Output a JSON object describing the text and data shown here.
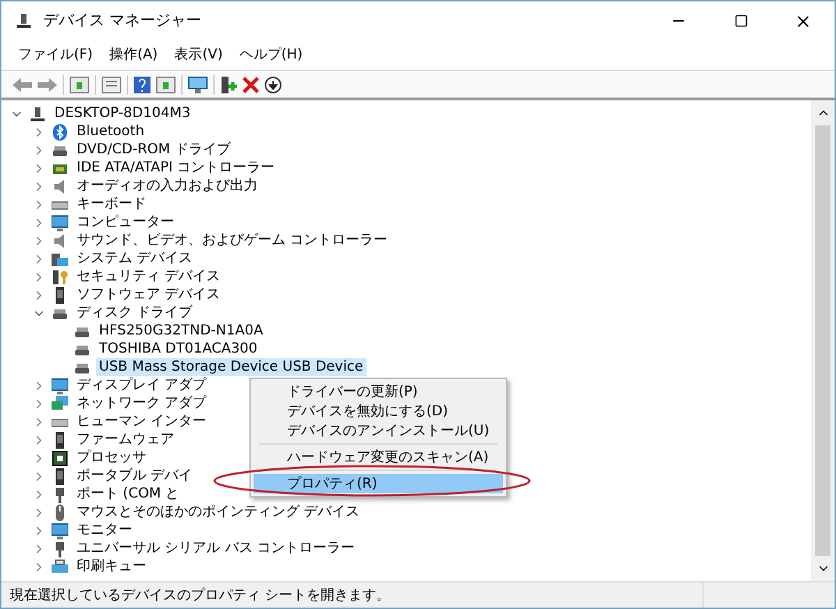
{
  "window": {
    "title": "デバイス マネージャー"
  },
  "menu_bar": [
    "ファイル(F)",
    "操作(A)",
    "表示(V)",
    "ヘルプ(H)"
  ],
  "tree": {
    "label": "DESKTOP-8D104M3",
    "expanded": true,
    "selected": false,
    "children": [
      {
        "label": "Bluetooth",
        "expanded": false,
        "selected": false
      },
      {
        "label": "DVD/CD-ROM ドライブ",
        "expanded": false,
        "selected": false
      },
      {
        "label": "IDE ATA/ATAPI コントローラー",
        "expanded": false,
        "selected": false
      },
      {
        "label": "オーディオの入力および出力",
        "expanded": false,
        "selected": false
      },
      {
        "label": "キーボード",
        "expanded": false,
        "selected": false
      },
      {
        "label": "コンピューター",
        "expanded": false,
        "selected": false
      },
      {
        "label": "サウンド、ビデオ、およびゲーム コントローラー",
        "expanded": false,
        "selected": false
      },
      {
        "label": "システム デバイス",
        "expanded": false,
        "selected": false
      },
      {
        "label": "セキュリティ デバイス",
        "expanded": false,
        "selected": false
      },
      {
        "label": "ソフトウェア デバイス",
        "expanded": false,
        "selected": false
      },
      {
        "label": "ディスク ドライブ",
        "expanded": true,
        "selected": false,
        "children": [
          {
            "label": "HFS250G32TND-N1A0A",
            "selected": false
          },
          {
            "label": "TOSHIBA DT01ACA300",
            "selected": false
          },
          {
            "label": "USB Mass Storage Device USB Device",
            "selected": true
          }
        ]
      },
      {
        "label": "ディスプレイ アダプ",
        "expanded": false,
        "selected": false
      },
      {
        "label": "ネットワーク アダプ",
        "expanded": false,
        "selected": false
      },
      {
        "label": "ヒューマン インター",
        "expanded": false,
        "selected": false
      },
      {
        "label": "ファームウェア",
        "expanded": false,
        "selected": false
      },
      {
        "label": "プロセッサ",
        "expanded": false,
        "selected": false
      },
      {
        "label": "ポータブル デバイ",
        "expanded": false,
        "selected": false
      },
      {
        "label": "ポート (COM と",
        "expanded": false,
        "selected": false
      },
      {
        "label": "マウスとそのほかのポインティング デバイス",
        "expanded": false,
        "selected": false
      },
      {
        "label": "モニター",
        "expanded": false,
        "selected": false
      },
      {
        "label": "ユニバーサル シリアル バス コントローラー",
        "expanded": false,
        "selected": false
      },
      {
        "label": "印刷キュー",
        "expanded": false,
        "selected": false
      }
    ]
  },
  "context_menu": [
    {
      "kind": "item",
      "label": "ドライバーの更新(P)",
      "selected": false
    },
    {
      "kind": "item",
      "label": "デバイスを無効にする(D)",
      "selected": false
    },
    {
      "kind": "item",
      "label": "デバイスのアンインストール(U)",
      "selected": false
    },
    {
      "kind": "separator"
    },
    {
      "kind": "item",
      "label": "ハードウェア変更のスキャン(A)",
      "selected": false
    },
    {
      "kind": "separator"
    },
    {
      "kind": "item",
      "label": "プロパティ(R)",
      "selected": true
    }
  ],
  "status_bar": "現在選択しているデバイスのプロパティ シートを開きます。"
}
